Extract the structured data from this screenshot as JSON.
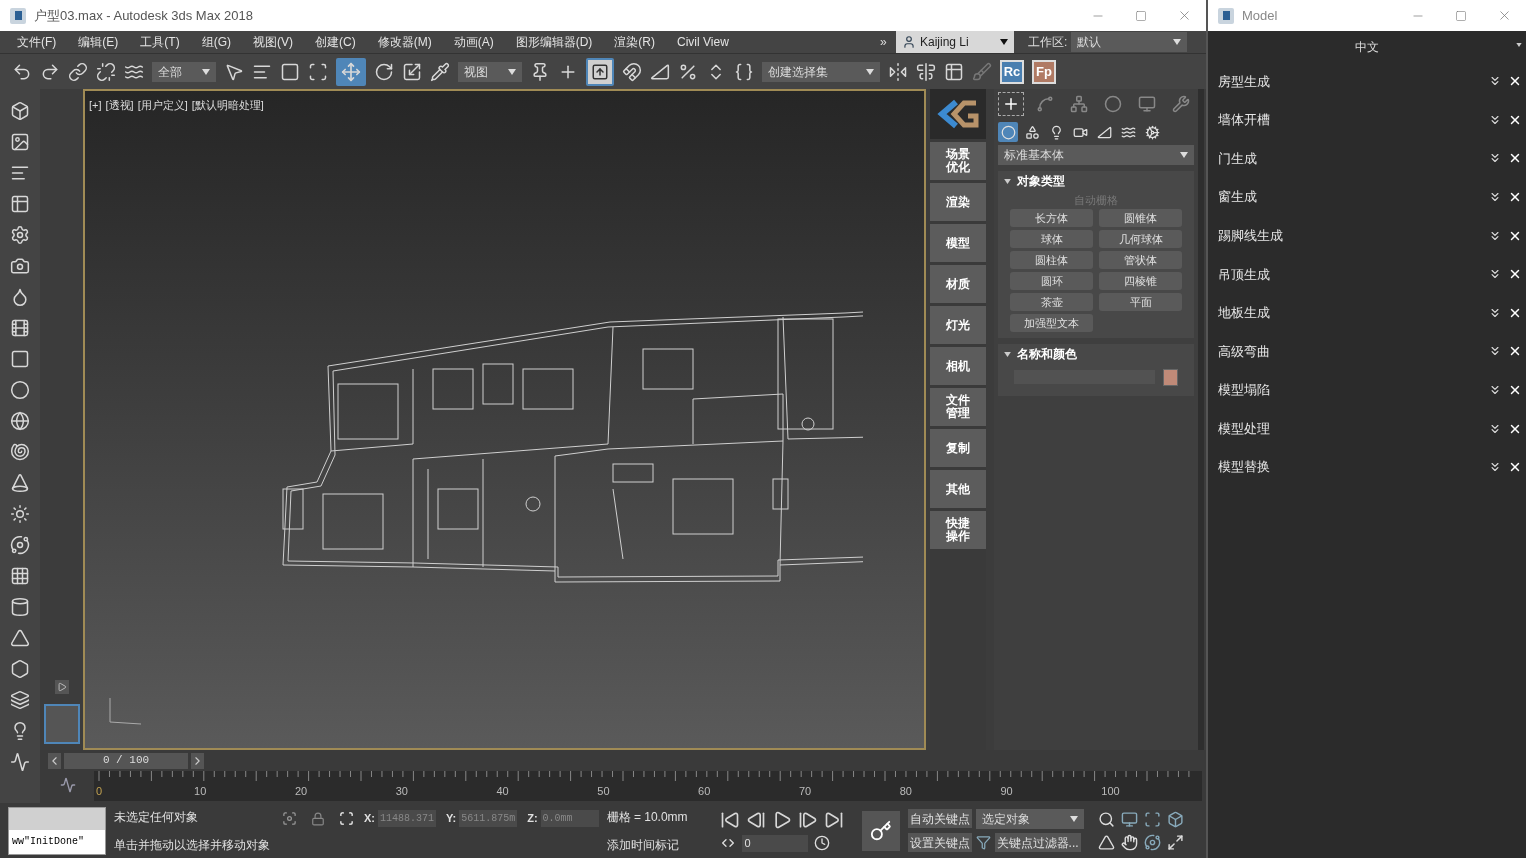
{
  "window": {
    "title": "户型03.max - Autodesk 3ds Max 2018"
  },
  "menu": [
    "文件(F)",
    "编辑(E)",
    "工具(T)",
    "组(G)",
    "视图(V)",
    "创建(C)",
    "修改器(M)",
    "动画(A)",
    "图形编辑器(D)",
    "渲染(R)",
    "Civil View"
  ],
  "menu_overflow": "»",
  "user": "Kaijing Li",
  "workspace": {
    "label": "工作区:",
    "value": "默认"
  },
  "toolbar": {
    "selection_filter": "全部",
    "coord_system": "视图",
    "selection_set": "创建选择集",
    "move_selected": true,
    "manipulate_selected": true,
    "plugins": [
      {
        "label": "Rc",
        "color": "#4a7fb0"
      },
      {
        "label": "Fp",
        "color": "#b07a64"
      }
    ]
  },
  "viewport": {
    "labels": [
      "[+]",
      "[透视]",
      "[用户定义]",
      "[默认明暗处理]"
    ]
  },
  "plugin_panel": {
    "buttons": [
      "场景优化",
      "渲染",
      "模型",
      "材质",
      "灯光",
      "相机",
      "文件管理",
      "复制",
      "其他",
      "快捷操作"
    ]
  },
  "command_panel": {
    "tabs": [
      {
        "selected": true
      },
      {
        "selected": false
      },
      {
        "selected": false
      },
      {
        "selected": false
      },
      {
        "selected": false
      },
      {
        "selected": false
      }
    ],
    "categories": [
      {
        "selected": true
      },
      {
        "selected": false
      },
      {
        "selected": false
      },
      {
        "selected": false
      },
      {
        "selected": false
      },
      {
        "selected": false
      },
      {
        "selected": false
      }
    ],
    "object_class": "标准基本体",
    "rollouts": [
      {
        "kind": "object_type",
        "title": "对象类型",
        "expanded": true,
        "autogrid": {
          "label": "自动栅格",
          "disabled": true
        },
        "buttons": [
          "长方体",
          "圆锥体",
          "球体",
          "几何球体",
          "圆柱体",
          "管状体",
          "圆环",
          "四棱锥",
          "茶壶",
          "平面",
          "加强型文本"
        ]
      },
      {
        "kind": "name_color",
        "title": "名称和颜色",
        "expanded": true,
        "color": "#c08a78"
      }
    ]
  },
  "time_slider": {
    "position": "0 / 100"
  },
  "trackbar": {
    "ticks": [
      "0",
      "10",
      "20",
      "30",
      "40",
      "50",
      "60",
      "70",
      "80",
      "90",
      "100"
    ]
  },
  "status": {
    "listener": "ww\"InitDone\"",
    "selection": "未选定任何对象",
    "prompt": "单击并拖动以选择并移动对象",
    "coords": [
      {
        "label": "X:",
        "value": "11488.371",
        "disabled": true
      },
      {
        "label": "Y:",
        "value": "5611.875m",
        "disabled": true
      },
      {
        "label": "Z:",
        "value": "0.0mm",
        "disabled": true
      }
    ],
    "grid": "栅格 = 10.0mm",
    "time_tag": "添加时间标记",
    "frame": "0",
    "auto_key": "自动关键点",
    "set_key": "设置关键点",
    "key_target": "选定对象",
    "key_filters": "关键点过滤器..."
  },
  "model_window": {
    "title": "Model",
    "language": "中文",
    "items": [
      "房型生成",
      "墙体开槽",
      "门生成",
      "窗生成",
      "踢脚线生成",
      "吊顶生成",
      "地板生成",
      "高级弯曲",
      "模型塌陷",
      "模型处理",
      "模型替换"
    ]
  }
}
